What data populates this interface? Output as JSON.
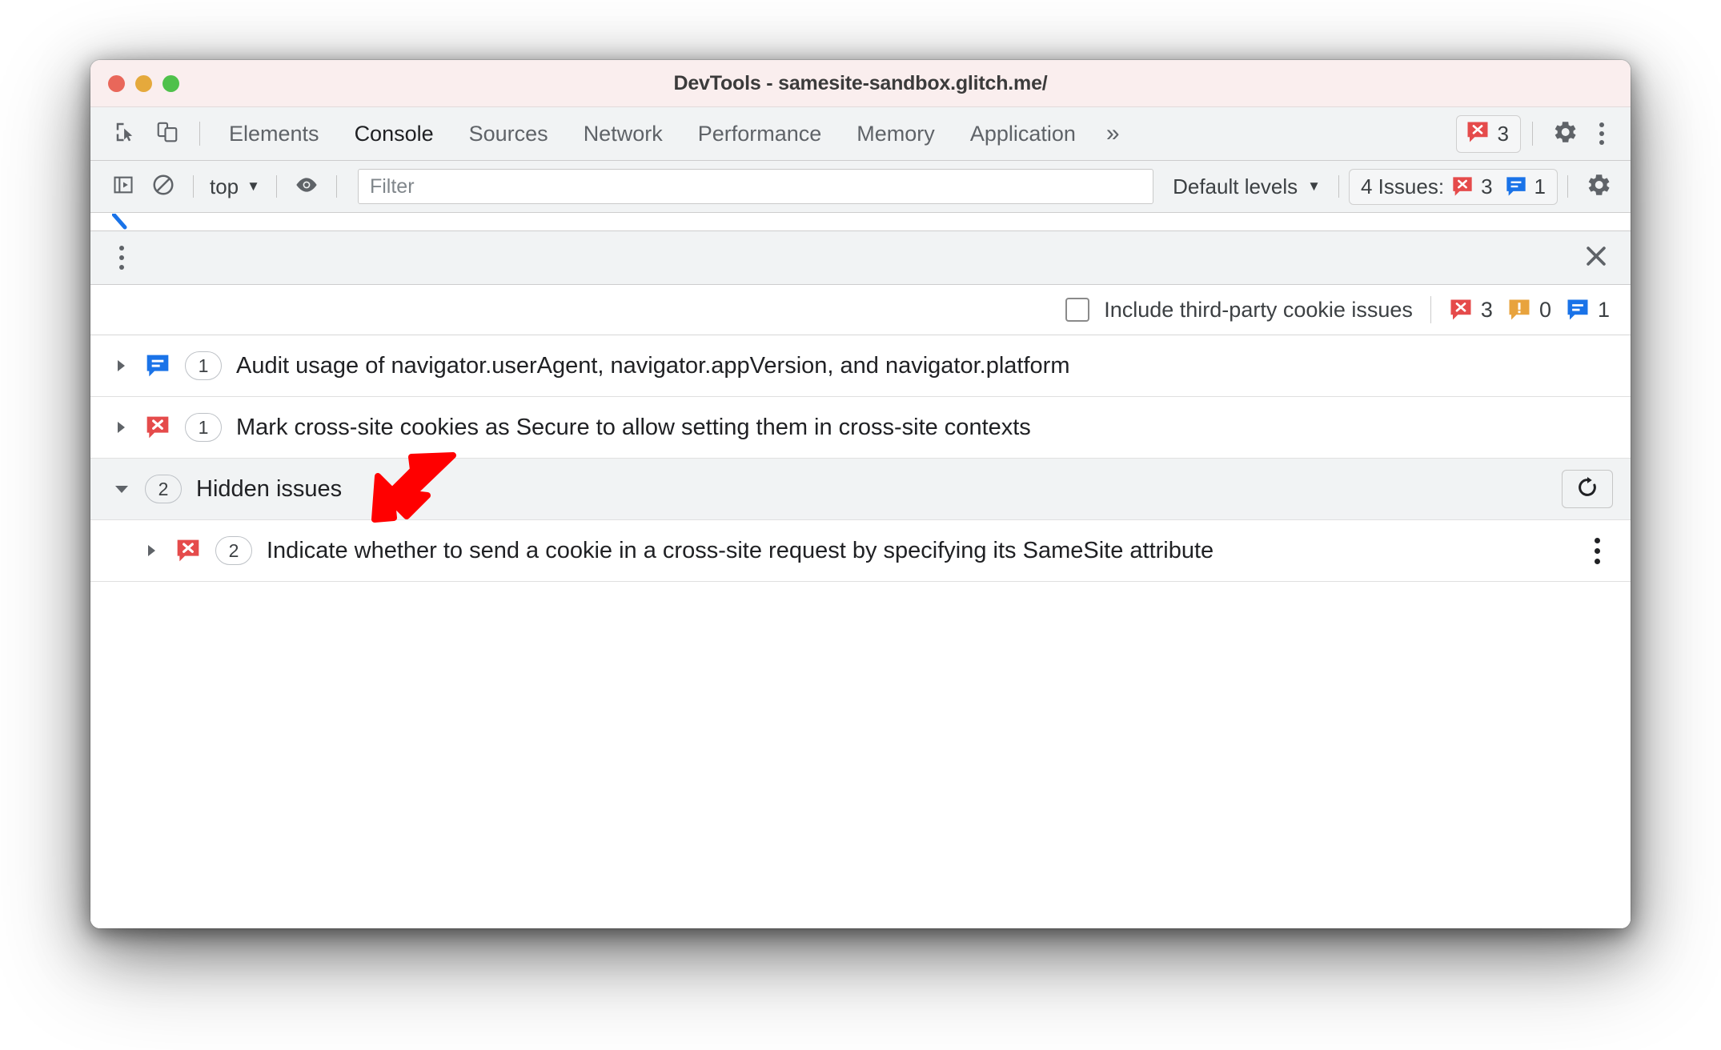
{
  "window": {
    "title": "DevTools - samesite-sandbox.glitch.me/",
    "traffic_lights": [
      "close-red",
      "minimize-yellow",
      "zoom-green"
    ]
  },
  "main_toolbar": {
    "icons": [
      {
        "name": "inspect-element-icon",
        "label": "Inspect element"
      },
      {
        "name": "device-toolbar-icon",
        "label": "Toggle device toolbar"
      }
    ],
    "tabs": [
      {
        "label": "Elements",
        "active": false
      },
      {
        "label": "Console",
        "active": true
      },
      {
        "label": "Sources",
        "active": false
      },
      {
        "label": "Network",
        "active": false
      },
      {
        "label": "Performance",
        "active": false
      },
      {
        "label": "Memory",
        "active": false
      },
      {
        "label": "Application",
        "active": false
      }
    ],
    "more_tabs": "»",
    "error_badge": {
      "icon": "error-issue-icon",
      "count": "3"
    },
    "settings_icon": "gear-icon",
    "menu_icon": "more-vertical-icon"
  },
  "console_toolbar": {
    "sidebar_toggle_icon": "console-sidebar-icon",
    "clear_icon": "clear-console-icon",
    "context": {
      "label": "top",
      "caret": "▼"
    },
    "eye_icon": "live-expression-icon",
    "filter": {
      "placeholder": "Filter",
      "value": ""
    },
    "levels": {
      "label": "Default levels",
      "caret": "▼"
    },
    "issues_summary": {
      "label": "4 Issues:",
      "error_count": "3",
      "info_count": "1"
    },
    "settings_icon": "gear-icon"
  },
  "issues_drawer": {
    "menu_icon": "more-vertical-icon",
    "close_icon": "close-icon",
    "third_party": {
      "checkbox_checked": false,
      "label": "Include third-party cookie issues",
      "counts": {
        "errors": "3",
        "warnings": "0",
        "info": "1"
      }
    },
    "rows": [
      {
        "expander": "▶",
        "expanded": false,
        "kind": "info",
        "count": "1",
        "text": "Audit usage of navigator.userAgent, navigator.appVersion, and navigator.platform"
      },
      {
        "expander": "▶",
        "expanded": false,
        "kind": "error",
        "count": "1",
        "text": "Mark cross-site cookies as Secure to allow setting them in cross-site contexts"
      }
    ],
    "hidden_group": {
      "expander": "▼",
      "expanded": true,
      "count": "2",
      "label": "Hidden issues",
      "restore_icon": "refresh-icon",
      "children": [
        {
          "expander": "▶",
          "expanded": false,
          "kind": "error",
          "count": "2",
          "text": "Indicate whether to send a cookie in a cross-site request by specifying its SameSite attribute",
          "menu_icon": "more-vertical-icon"
        }
      ]
    }
  },
  "annotation": {
    "arrow": "red-arrow-pointing-down-left",
    "color": "#ff0000"
  },
  "colors": {
    "error_red": "#e54b4b",
    "warning_orange": "#e8a33d",
    "info_blue": "#1a73e8",
    "titlebar_bg": "#faeeee",
    "toolbar_bg": "#f1f3f4",
    "accent": "#1a73e8"
  }
}
